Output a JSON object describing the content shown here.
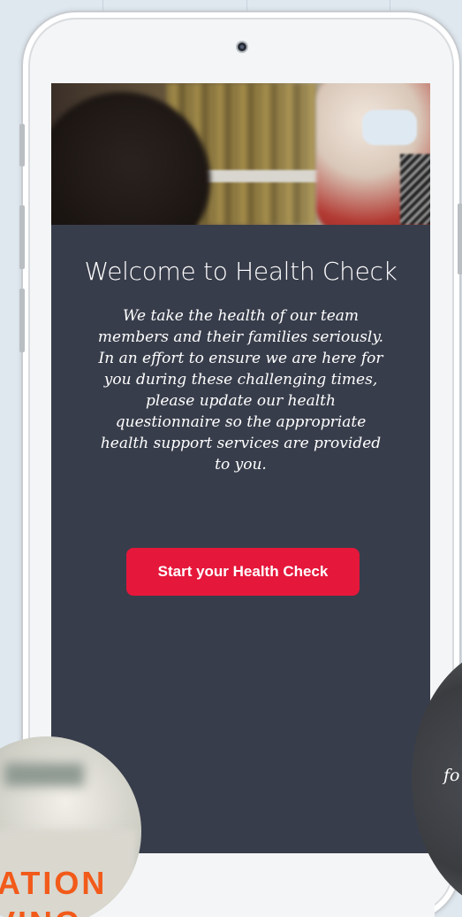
{
  "screen": {
    "title": "Welcome to Health Check",
    "message": "We take the health of our team members and their families seriously. In an effort to ensure we are here for you during these challenging times, please update our health questionnaire so the appropriate health support services are provided to you.",
    "cta_label": "Start your Health Check"
  },
  "background_cards": {
    "left_circle_line1": "ATION",
    "left_circle_line2": "VING",
    "right_circle_text": "fo"
  },
  "colors": {
    "screen_background": "#383d4b",
    "cta_background": "#e5173b",
    "promo_text": "#f25a1a",
    "page_background": "#dfe7ef"
  }
}
